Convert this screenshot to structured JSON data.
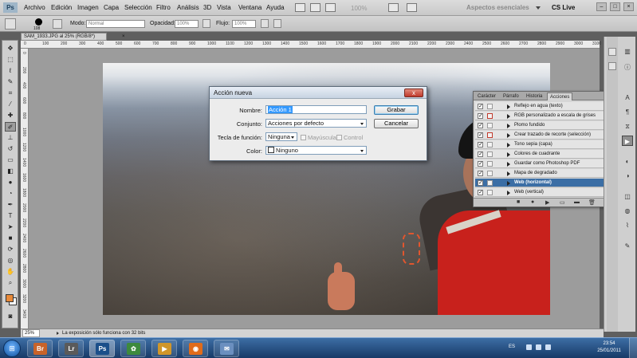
{
  "app": {
    "logo": "Ps",
    "menu": [
      "Archivo",
      "Edición",
      "Imagen",
      "Capa",
      "Selección",
      "Filtro",
      "Análisis",
      "3D",
      "Vista",
      "Ventana",
      "Ayuda"
    ],
    "zoom_readout": "100%",
    "workspace": "Aspectos esenciales",
    "cs_live": "CS Live",
    "window_buttons": [
      "–",
      "□",
      "×"
    ]
  },
  "options_bar": {
    "brush_size": "108",
    "mode_label": "Modo:",
    "mode_value": "Normal",
    "opacity_label": "Opacidad:",
    "opacity_value": "100%",
    "flow_label": "Flujo:",
    "flow_value": "100%"
  },
  "document": {
    "tab_title": "SAM_1933.JPG al 25% (RGB/8*)",
    "tab_close": "×"
  },
  "rulers": {
    "top": [
      "0",
      "100",
      "200",
      "300",
      "400",
      "500",
      "600",
      "700",
      "800",
      "900",
      "1000",
      "1100",
      "1200",
      "1300",
      "1400",
      "1500",
      "1600",
      "1700",
      "1800",
      "1900",
      "2000",
      "2100",
      "2200",
      "2300",
      "2400",
      "2500",
      "2600",
      "2700",
      "2800",
      "2900",
      "3000",
      "3100"
    ],
    "left": [
      "0",
      "200",
      "400",
      "600",
      "800",
      "1000",
      "1200",
      "1400",
      "1600",
      "1800",
      "2000",
      "2200",
      "2400",
      "2600",
      "2800",
      "3000",
      "3200",
      "3400"
    ]
  },
  "dialog": {
    "title": "Acción nueva",
    "close": "x",
    "name_label": "Nombre:",
    "name_value": "Acción 1",
    "set_label": "Conjunto:",
    "set_value": "Acciones por defecto",
    "fkey_label": "Tecla de función:",
    "fkey_value": "Ninguna",
    "shift_label": "Mayúsculas",
    "control_label": "Control",
    "color_label": "Color:",
    "color_value": "Ninguno",
    "record_button": "Grabar",
    "cancel_button": "Cancelar"
  },
  "actions_panel": {
    "tabs": [
      "Carácter",
      "Párrafo",
      "Historia",
      "Acciones"
    ],
    "active_tab": "Acciones",
    "items": [
      {
        "name": "Reflejo en agua (texto)",
        "key": ""
      },
      {
        "name": "RGB personalizado a escala de grises",
        "key": ""
      },
      {
        "name": "Plomo fundido",
        "key": ""
      },
      {
        "name": "Crear trazado de recorte (selección)",
        "key": ""
      },
      {
        "name": "Tono sepia (capa)",
        "key": ""
      },
      {
        "name": "Colores de cuadrante",
        "key": ""
      },
      {
        "name": "Guardar como Photoshop PDF",
        "key": ""
      },
      {
        "name": "Mapa de degradado",
        "key": ""
      },
      {
        "name": "Web (horizontal)",
        "key": "F9"
      },
      {
        "name": "Web (vertical)",
        "key": "F10"
      }
    ],
    "footer_icons": [
      "■",
      "●",
      "▶",
      "▭",
      "▬",
      "🗑"
    ]
  },
  "status": {
    "zoom": "25%",
    "message": "La exposición sólo funciona con 32 bits"
  },
  "taskbar": {
    "apps": [
      {
        "label": "Br",
        "color": "#c8632a"
      },
      {
        "label": "Lr",
        "color": "#5a5a5a"
      },
      {
        "label": "Ps",
        "color": "#1b4f8a"
      },
      {
        "label": "✿",
        "color": "#3d8a3d"
      },
      {
        "label": "▶",
        "color": "#d0962a"
      },
      {
        "label": "◉",
        "color": "#e06b1a"
      },
      {
        "label": "✉",
        "color": "#6b8fbf"
      }
    ],
    "language": "ES",
    "time": "23:54",
    "date": "25/01/2011"
  },
  "colors": {
    "foreground": "#e88a3a",
    "background": "#ffffff",
    "selected_row": "#3b6ea5"
  }
}
